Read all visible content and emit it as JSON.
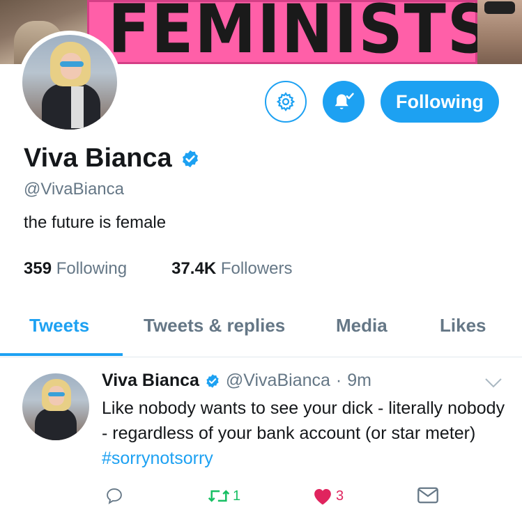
{
  "banner": {
    "sign_text": "FEMINISTS"
  },
  "profile": {
    "name": "Viva Bianca",
    "handle": "@VivaBianca",
    "bio": "the future is female",
    "following_count": "359",
    "following_label": "Following",
    "followers_count": "37.4K",
    "followers_label": "Followers"
  },
  "buttons": {
    "follow_label": "Following"
  },
  "tabs": [
    {
      "label": "Tweets",
      "active": true
    },
    {
      "label": "Tweets & replies",
      "active": false
    },
    {
      "label": "Media",
      "active": false
    },
    {
      "label": "Likes",
      "active": false
    }
  ],
  "tweet": {
    "name": "Viva Bianca",
    "handle": "@VivaBianca",
    "separator": "·",
    "time": "9m",
    "text": "Like nobody wants to see your dick - literally nobody - regardless of your bank account (or star meter) ",
    "hashtag": "#sorrynotsorry",
    "retweets": "1",
    "likes": "3"
  },
  "colors": {
    "accent": "#1da1f2",
    "retweet": "#17bf63",
    "like": "#e0245e",
    "muted": "#657786"
  }
}
